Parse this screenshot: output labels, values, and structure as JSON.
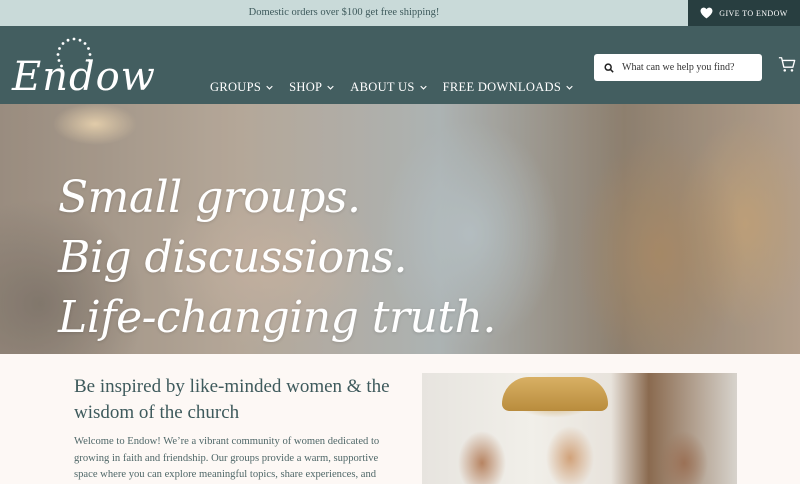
{
  "announcement": {
    "text": "Domestic orders over $100 get free shipping!",
    "give_label": "GIVE TO ENDOW",
    "give_icon": "heart-icon"
  },
  "header": {
    "logo_text": "Endow",
    "nav": [
      {
        "label": "GROUPS"
      },
      {
        "label": "SHOP"
      },
      {
        "label": "ABOUT US"
      },
      {
        "label": "FREE DOWNLOADS"
      }
    ],
    "search": {
      "placeholder": "What can we help you find?",
      "icon": "search-icon"
    },
    "cart_icon": "cart-icon"
  },
  "hero": {
    "lines": [
      "Small groups.",
      "Big discussions.",
      "Life-changing truth."
    ]
  },
  "intro": {
    "heading": "Be inspired by like-minded women & the wisdom of the church",
    "body": "Welcome to Endow!  We’re a vibrant community of women dedicated to growing in faith and friendship.  Our groups provide a warm, supportive space where you can explore meaningful topics, share experiences, and"
  },
  "colors": {
    "announce_bg": "#c9dad9",
    "header_bg": "#435e60",
    "give_bg": "#283e40",
    "text_teal": "#3e5a5c",
    "page_bg": "#fdf8f5"
  }
}
